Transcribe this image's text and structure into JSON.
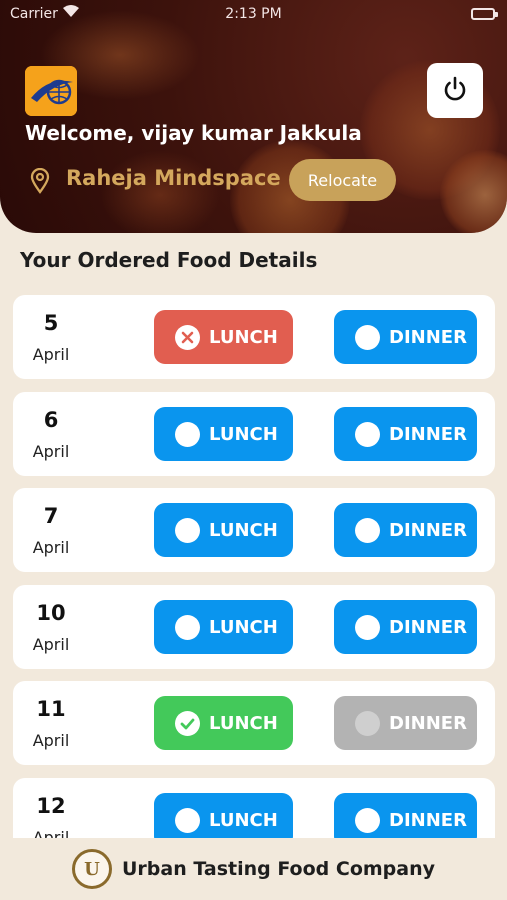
{
  "status_bar": {
    "carrier": "Carrier",
    "time": "2:13 PM"
  },
  "header": {
    "welcome": "Welcome, vijay kumar Jakkula",
    "location": "Raheja Mindspace",
    "relocate_label": "Relocate"
  },
  "section_title": "Your Ordered Food Details",
  "days": [
    {
      "day": "5",
      "month": "April",
      "lunch": {
        "label": "LUNCH",
        "state": "cancelled",
        "color": "#e15e50"
      },
      "dinner": {
        "label": "DINNER",
        "state": "available",
        "color": "#0a95ee"
      }
    },
    {
      "day": "6",
      "month": "April",
      "lunch": {
        "label": "LUNCH",
        "state": "available",
        "color": "#0a95ee"
      },
      "dinner": {
        "label": "DINNER",
        "state": "available",
        "color": "#0a95ee"
      }
    },
    {
      "day": "7",
      "month": "April",
      "lunch": {
        "label": "LUNCH",
        "state": "available",
        "color": "#0a95ee"
      },
      "dinner": {
        "label": "DINNER",
        "state": "available",
        "color": "#0a95ee"
      }
    },
    {
      "day": "10",
      "month": "April",
      "lunch": {
        "label": "LUNCH",
        "state": "available",
        "color": "#0a95ee"
      },
      "dinner": {
        "label": "DINNER",
        "state": "available",
        "color": "#0a95ee"
      }
    },
    {
      "day": "11",
      "month": "April",
      "lunch": {
        "label": "LUNCH",
        "state": "ordered",
        "color": "#43c95a"
      },
      "dinner": {
        "label": "DINNER",
        "state": "disabled",
        "color": "#b3b3b3"
      }
    },
    {
      "day": "12",
      "month": "April",
      "lunch": {
        "label": "LUNCH",
        "state": "available",
        "color": "#0a95ee"
      },
      "dinner": {
        "label": "DINNER",
        "state": "available",
        "color": "#0a95ee"
      }
    }
  ],
  "footer": {
    "logo_letter": "U",
    "company_name": "Urban Tasting Food Company"
  },
  "colors": {
    "hero_background": "#3c120c",
    "page_background": "#f2e9dc",
    "accent_gold": "#c8a25a",
    "available_blue": "#0a95ee",
    "cancelled_red": "#e15e50",
    "ordered_green": "#43c95a",
    "disabled_grey": "#b3b3b3"
  },
  "icons": {
    "logo": "globe-logo-icon",
    "power": "power-icon",
    "location": "location-pin-icon",
    "cancelled": "cross-circle-icon",
    "ordered": "check-circle-icon",
    "available": "empty-circle-icon"
  }
}
